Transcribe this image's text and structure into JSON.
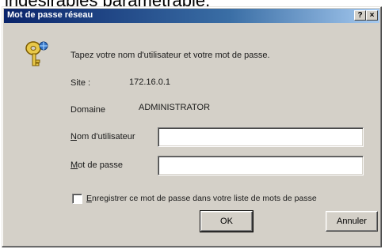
{
  "caption": "indésirables paramétrable.",
  "dialog": {
    "title": "Mot de passe réseau",
    "help_glyph": "?",
    "close_glyph": "×"
  },
  "message": "Tapez votre nom d'utilisateur et votre mot de passe.",
  "site": {
    "label": "Site :",
    "value": "172.16.0.1"
  },
  "domain": {
    "label": "Domaine",
    "value": "ADMINISTRATOR"
  },
  "username": {
    "label_access": "N",
    "label_rest": "om d'utilisateur",
    "value": ""
  },
  "password": {
    "label_access": "M",
    "label_rest": "ot de passe",
    "value": ""
  },
  "save_checkbox": {
    "label_access": "E",
    "label_rest": "nregistrer ce mot de passe dans votre liste de mots de passe",
    "checked": false
  },
  "buttons": {
    "ok": "OK",
    "cancel": "Annuler"
  },
  "icon": "key-icon"
}
